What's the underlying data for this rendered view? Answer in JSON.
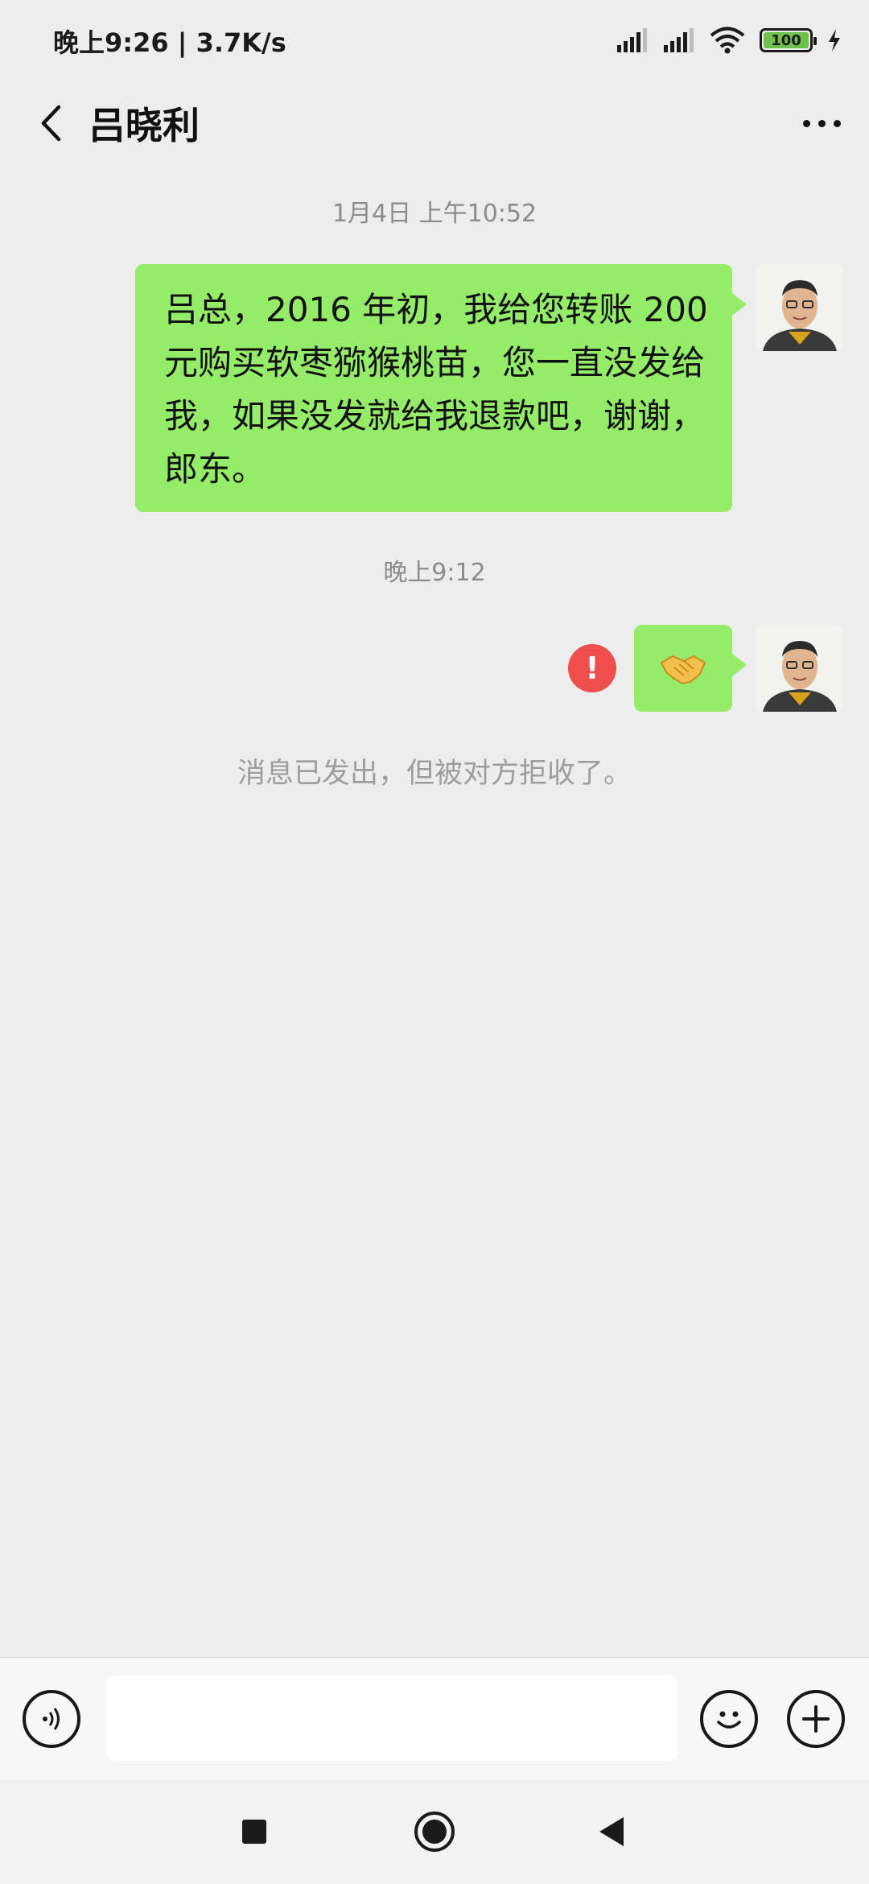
{
  "status_bar": {
    "time_speed": "晚上9:26 | 3.7K/s",
    "battery": "100",
    "icons": [
      "signal-icon",
      "signal-icon-2",
      "wifi-icon",
      "battery-icon",
      "charging-icon"
    ]
  },
  "header": {
    "title": "吕晓利",
    "back_icon": "chevron-left-icon",
    "more_icon": "more-dots-icon"
  },
  "messages": [
    {
      "type": "timestamp",
      "text": "1月4日 上午10:52"
    },
    {
      "type": "outgoing",
      "text": "吕总，2016 年初，我给您转账 200 元购买软枣猕猴桃苗，您一直没发给我，如果没发就给我退款吧，谢谢，郎东。"
    },
    {
      "type": "timestamp",
      "text": "晚上9:12"
    },
    {
      "type": "outgoing",
      "emoji": "🤝",
      "status": "failed"
    },
    {
      "type": "system",
      "text": "消息已发出，但被对方拒收了。"
    }
  ],
  "input_bar": {
    "value": "",
    "placeholder": "",
    "voice_icon": "voice-icon",
    "emoji_icon": "emoji-icon",
    "plus_icon": "plus-icon"
  },
  "colors": {
    "background": "#ededed",
    "bubble_green": "#95ec69",
    "error_red": "#f04d4d",
    "battery_green": "#6cc24a"
  }
}
